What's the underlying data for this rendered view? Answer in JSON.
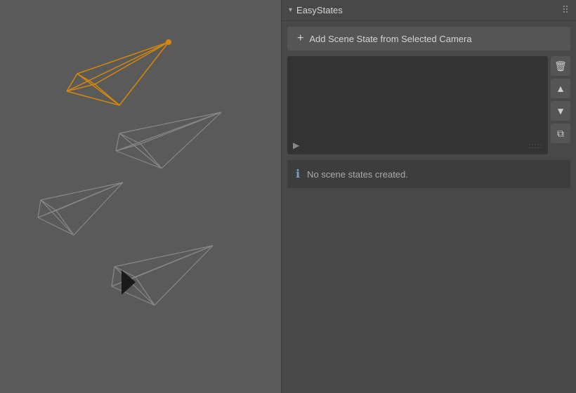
{
  "panel": {
    "title": "EasyStates",
    "add_button_label": "Add Scene State from Selected Camera",
    "no_states_message": "No scene states created.",
    "icons": {
      "chevron": "▾",
      "grid": "⠿",
      "plus": "+",
      "play": "▶",
      "drag": ":::::",
      "trash": "🗑",
      "arrow_up": "▲",
      "arrow_down": "▼",
      "copy": "⧉",
      "info": "ℹ"
    }
  }
}
